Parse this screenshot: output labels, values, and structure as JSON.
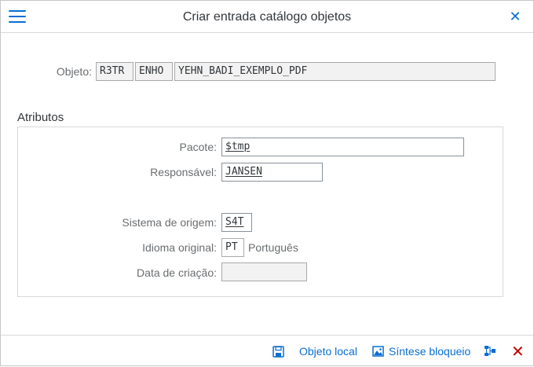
{
  "dialog": {
    "title": "Criar entrada catálogo objetos"
  },
  "object": {
    "label": "Objeto:",
    "pgmid": "R3TR",
    "type": "ENHO",
    "name": "YEHN_BADI_EXEMPLO_PDF"
  },
  "attributes": {
    "section_title": "Atributos",
    "package_label": "Pacote:",
    "package_value": "$tmp",
    "responsible_label": "Responsável:",
    "responsible_value": "JANSEN",
    "source_system_label": "Sistema de origem:",
    "source_system_value": "S4T",
    "original_language_label": "Idioma original:",
    "original_language_value": "PT",
    "original_language_text": "Português",
    "creation_date_label": "Data de criação:",
    "creation_date_value": ""
  },
  "footer": {
    "local_object_label": "Objeto local",
    "lock_overview_label": "Síntese bloqueio"
  },
  "colors": {
    "accent": "#0a6ed1",
    "cancel": "#bb0000"
  }
}
